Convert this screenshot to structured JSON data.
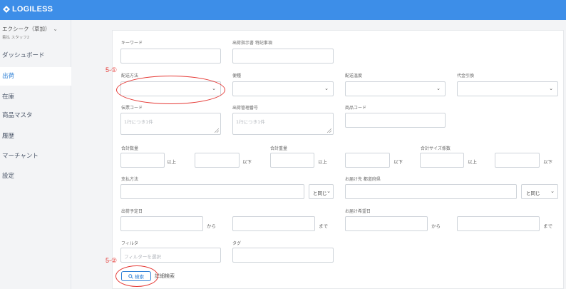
{
  "app": {
    "logo_text": "LOGILESS"
  },
  "sidebar": {
    "org_name": "エクシーク（草加）",
    "org_sub": "着払 スタッフ2",
    "items": [
      {
        "label": "ダッシュボード",
        "active": false
      },
      {
        "label": "出荷",
        "active": true
      },
      {
        "label": "在庫",
        "active": false
      },
      {
        "label": "商品マスタ",
        "active": false
      },
      {
        "label": "履歴",
        "active": false
      },
      {
        "label": "マーチャント",
        "active": false
      },
      {
        "label": "設定",
        "active": false
      }
    ]
  },
  "form": {
    "keyword": {
      "label": "キーワード",
      "value": ""
    },
    "shipping_instruction": {
      "label": "出荷指示書 特記事項",
      "value": ""
    },
    "delivery_method": {
      "label": "配送方法",
      "value": ""
    },
    "carrier_type": {
      "label": "便種",
      "value": ""
    },
    "shipping_speed": {
      "label": "配送温度",
      "value": ""
    },
    "cod": {
      "label": "代金引換",
      "value": ""
    },
    "slip_code": {
      "label": "伝票コード",
      "placeholder": "1行につき1件"
    },
    "mgmt_number": {
      "label": "出荷管理番号",
      "placeholder": "1行につき1件"
    },
    "product_code": {
      "label": "商品コード",
      "value": ""
    },
    "total_qty": {
      "label": "合計数量",
      "min_suffix": "以上",
      "max_suffix": "以下"
    },
    "total_weight": {
      "label": "合計重量",
      "min_suffix": "以上",
      "max_suffix": "以下"
    },
    "total_size": {
      "label": "合計サイズ係数",
      "min_suffix": "以上",
      "max_suffix": "以下"
    },
    "payment_method": {
      "label": "支払方法",
      "match": "と同じ"
    },
    "delivery_address": {
      "label": "お届け先 都道府県",
      "match": "と同じ"
    },
    "ship_date": {
      "label": "出荷予定日",
      "from_suffix": "から",
      "to_suffix": "まで"
    },
    "delivery_date": {
      "label": "お届け希望日",
      "from_suffix": "から",
      "to_suffix": "まで"
    },
    "filter": {
      "label": "フィルタ",
      "placeholder": "フィルターを選択"
    },
    "tag": {
      "label": "タグ",
      "value": ""
    },
    "search_button": "検索",
    "advanced_search": "詳細検索"
  },
  "annotations": {
    "step1": "5-①",
    "step2": "5-②",
    "color": "#e53935"
  },
  "colors": {
    "accent": "#3d8ee8",
    "active_nav": "#2f80d6"
  }
}
